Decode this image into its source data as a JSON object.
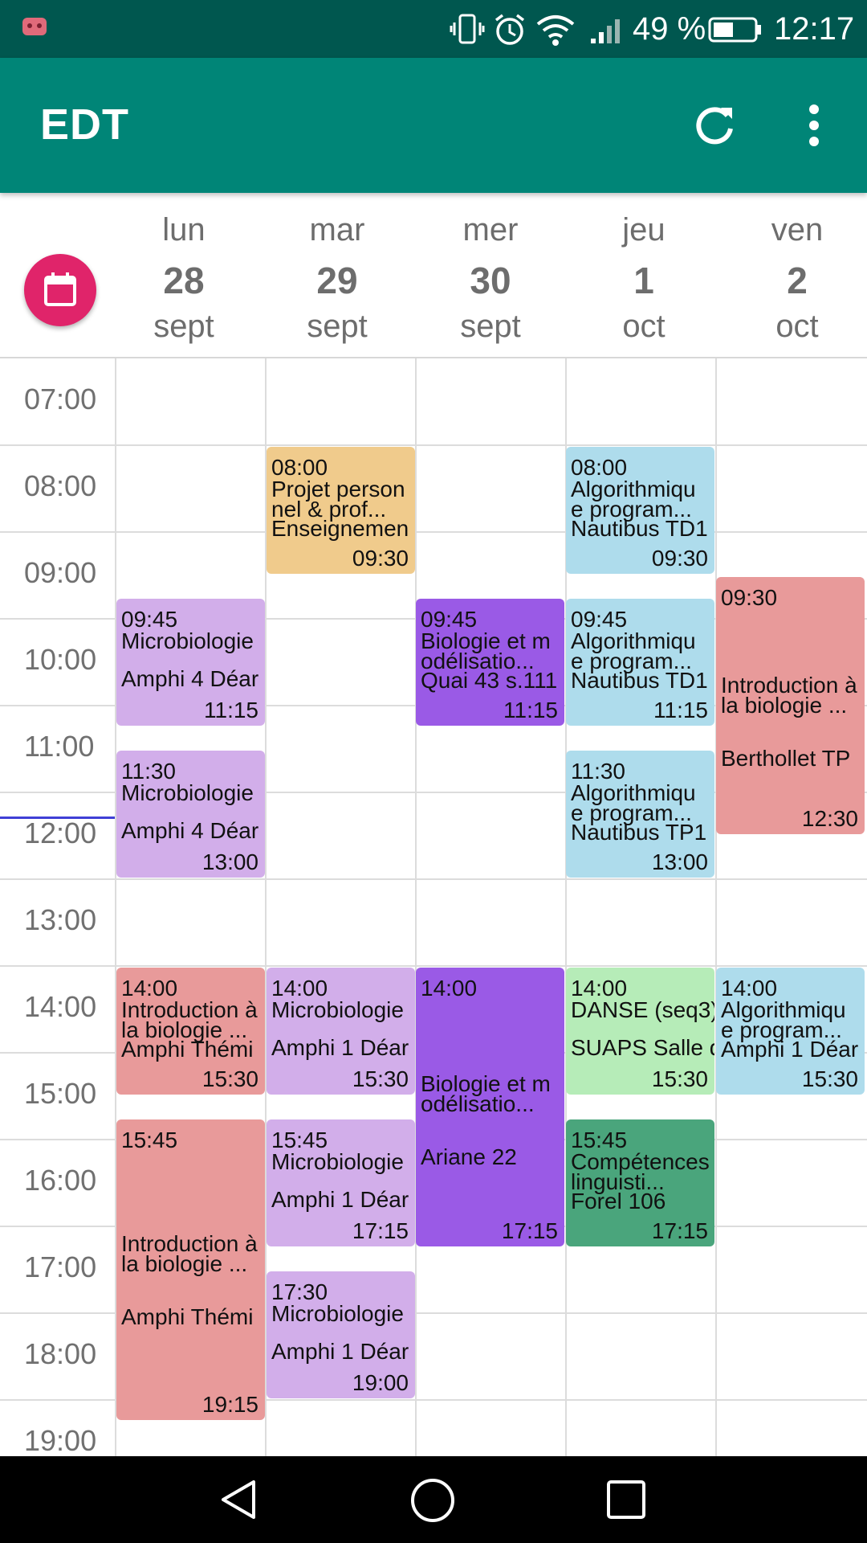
{
  "status_bar": {
    "time": "12:17",
    "battery_percent": "49 %",
    "icons": [
      "app-notification-icon",
      "vibrate-icon",
      "alarm-icon",
      "wifi-icon",
      "signal-icon",
      "battery-icon"
    ]
  },
  "app_bar": {
    "title": "EDT",
    "icons": [
      "refresh-icon",
      "more-vert-icon"
    ]
  },
  "calendar_fab": {
    "icon": "calendar-icon",
    "color": "#e0246a"
  },
  "days": [
    {
      "name": "lun",
      "num": "28",
      "month": "sept"
    },
    {
      "name": "mar",
      "num": "29",
      "month": "sept"
    },
    {
      "name": "mer",
      "num": "30",
      "month": "sept"
    },
    {
      "name": "jeu",
      "num": "1",
      "month": "oct"
    },
    {
      "name": "ven",
      "num": "2",
      "month": "oct"
    }
  ],
  "hours": [
    "07:00",
    "08:00",
    "09:00",
    "10:00",
    "11:00",
    "12:00",
    "13:00",
    "14:00",
    "15:00",
    "16:00",
    "17:00",
    "18:00",
    "19:00"
  ],
  "current_time_line": "12:17",
  "colors": {
    "primary": "#008577",
    "primary_dark": "#00574f",
    "current_time": "#3f3fd6"
  },
  "events": [
    {
      "day": 0,
      "start": "09:45",
      "end": "11:15",
      "title": "Microbiologie",
      "room": "Amphi 4 Déar",
      "color": "#d2aeea"
    },
    {
      "day": 0,
      "start": "11:30",
      "end": "13:00",
      "title": "Microbiologie",
      "room": "Amphi 4 Déar",
      "color": "#d2aeea"
    },
    {
      "day": 0,
      "start": "14:00",
      "end": "15:30",
      "title": "Introduction à\nla biologie ...",
      "room": "Amphi Thémi",
      "color": "#e89a9a"
    },
    {
      "day": 0,
      "start": "15:45",
      "end": "19:15",
      "title": "Introduction à\nla biologie ...",
      "room": "Amphi Thémi",
      "color": "#e89a9a"
    },
    {
      "day": 1,
      "start": "08:00",
      "end": "09:30",
      "title": "Projet person\nnel & prof...",
      "room": "Enseignemen",
      "color": "#f0cb8c"
    },
    {
      "day": 1,
      "start": "14:00",
      "end": "15:30",
      "title": "Microbiologie",
      "room": "Amphi 1 Déar",
      "color": "#d2aeea"
    },
    {
      "day": 1,
      "start": "15:45",
      "end": "17:15",
      "title": "Microbiologie",
      "room": "Amphi 1 Déar",
      "color": "#d2aeea"
    },
    {
      "day": 1,
      "start": "17:30",
      "end": "19:00",
      "title": "Microbiologie",
      "room": "Amphi 1 Déar",
      "color": "#d2aeea"
    },
    {
      "day": 2,
      "start": "09:45",
      "end": "11:15",
      "title": "Biologie et m\nodélisatio...",
      "room": "Quai 43 s.111",
      "color": "#9a5ae6"
    },
    {
      "day": 2,
      "start": "14:00",
      "end": "17:15",
      "title": "Biologie et m\nodélisatio...",
      "room": "Ariane 22",
      "color": "#9a5ae6"
    },
    {
      "day": 3,
      "start": "08:00",
      "end": "09:30",
      "title": "Algorithmiqu\ne program...",
      "room": "Nautibus TD1",
      "color": "#aedcec"
    },
    {
      "day": 3,
      "start": "09:45",
      "end": "11:15",
      "title": "Algorithmiqu\ne program...",
      "room": "Nautibus TD1",
      "color": "#aedcec"
    },
    {
      "day": 3,
      "start": "11:30",
      "end": "13:00",
      "title": "Algorithmiqu\ne program...",
      "room": "Nautibus TP1",
      "color": "#aedcec"
    },
    {
      "day": 3,
      "start": "14:00",
      "end": "15:30",
      "title": "DANSE (seq3)",
      "room": "SUAPS Salle d",
      "color": "#b6ecb8"
    },
    {
      "day": 3,
      "start": "15:45",
      "end": "17:15",
      "title": "Compétences\nlinguisti...",
      "room": "Forel 106",
      "color": "#4aa57c"
    },
    {
      "day": 4,
      "start": "09:30",
      "end": "12:30",
      "title": "Introduction à\nla biologie ...",
      "room": "Berthollet TP",
      "color": "#e89a9a"
    },
    {
      "day": 4,
      "start": "14:00",
      "end": "15:30",
      "title": "Algorithmiqu\ne program...",
      "room": "Amphi 1 Déar",
      "color": "#aedcec"
    }
  ]
}
